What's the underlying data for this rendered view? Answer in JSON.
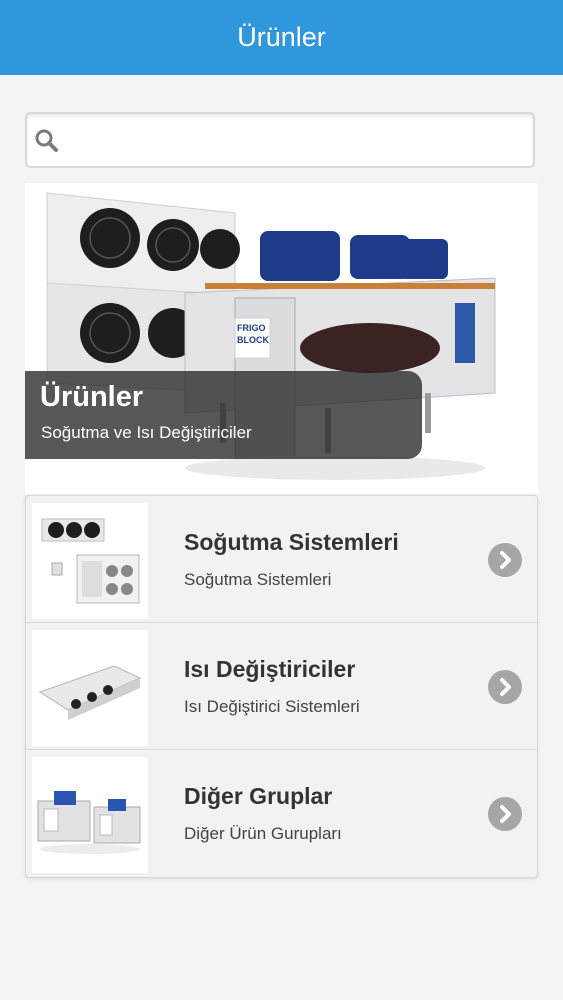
{
  "header": {
    "title": "Ürünler"
  },
  "search": {
    "placeholder": "",
    "value": "",
    "icon": "search-icon"
  },
  "hero": {
    "title": "Ürünler",
    "subtitle": "Soğutma ve Isı Değiştiriciler",
    "brand_mark": "FRIGO BLOCK"
  },
  "categories": [
    {
      "title": "Soğutma Sistemleri",
      "description": "Soğutma Sistemleri",
      "icon": "chevron-right-icon"
    },
    {
      "title": "Isı Değiştiriciler",
      "description": "Isı Değiştirici Sistemleri",
      "icon": "chevron-right-icon"
    },
    {
      "title": "Diğer Gruplar",
      "description": "Diğer Ürün Gurupları",
      "icon": "chevron-right-icon"
    }
  ],
  "colors": {
    "header_bg": "#2f97db",
    "page_bg": "#f4f3f5",
    "chevron_bg": "#a6a6a6",
    "caption_bg": "#282828"
  }
}
